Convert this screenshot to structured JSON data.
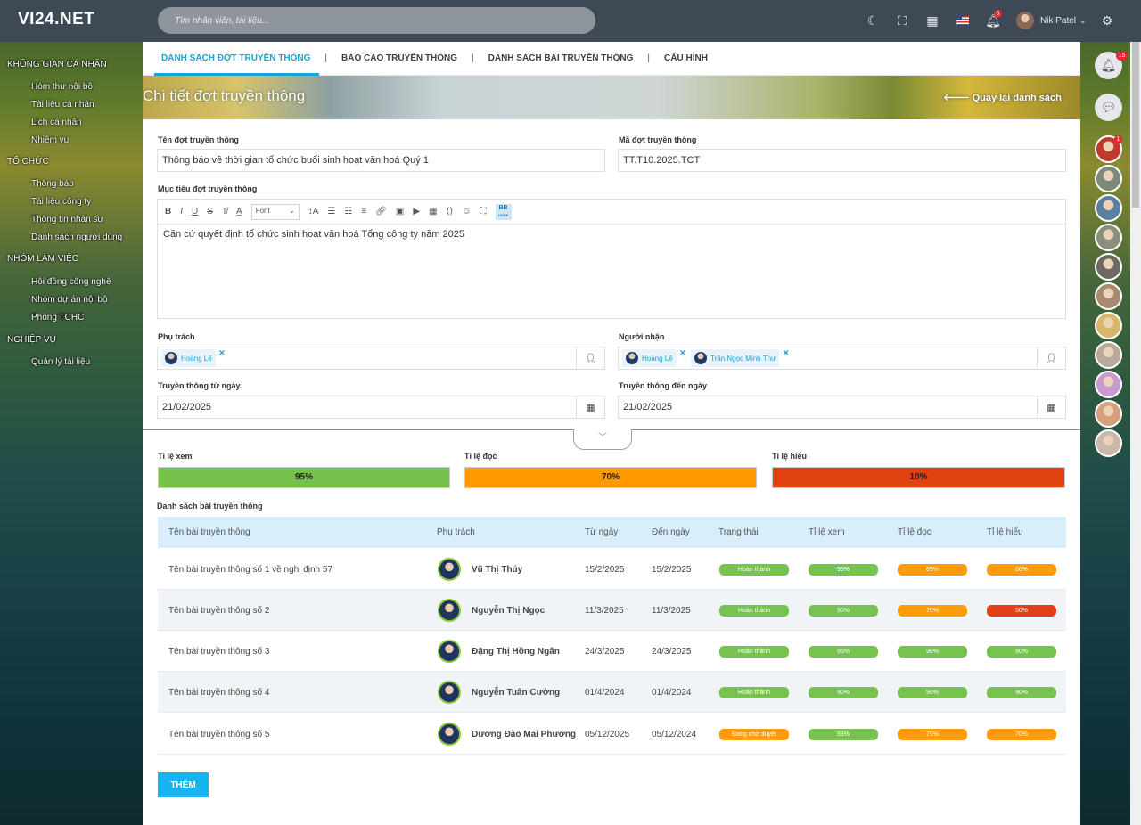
{
  "app": {
    "logo": "VI24.NET",
    "search_placeholder": "Tìm nhân viên, tài liệu...",
    "user_name": "Nik Patel",
    "user_caret": "⌄",
    "notif_count": "6"
  },
  "sidebar": [
    {
      "section": "KHÔNG GIAN CÁ NHÂN",
      "items": [
        "Hòm thư nội bộ",
        "Tài liệu cá nhân",
        "Lịch cá nhân",
        "Nhiệm vụ"
      ]
    },
    {
      "section": "TỔ CHỨC",
      "items": [
        "Thông báo",
        "Tài liệu công ty",
        "Thông tin nhân sự",
        "Danh sách người dùng"
      ]
    },
    {
      "section": "NHÓM LÀM VIỆC",
      "items": [
        "Hội đồng công nghệ",
        "Nhóm dự án nội bộ",
        "Phòng TCHC"
      ]
    },
    {
      "section": "NGHIỆP VỤ",
      "items": [
        "Quản lý tài liệu"
      ]
    }
  ],
  "tabs": [
    "DANH SÁCH ĐỢT TRUYỀN THÔNG",
    "BÁO CÁO TRUYỀN THÔNG",
    "DANH SÁCH BÀI TRUYỀN THÔNG",
    "CẤU HÌNH"
  ],
  "tab_sep": "|",
  "banner": {
    "title": "Chi tiết đợt truyền thông",
    "back": "Quay lại danh sách"
  },
  "form": {
    "name_label": "Tên đợt truyền thông",
    "name_value": "Thông báo về thời gian tổ chức buổi sinh hoạt văn hoá Quý 1",
    "code_label": "Mã đợt truyền thông",
    "code_value": "TT.T10.2025.TCT",
    "goal_label": "Mục tiêu đợt truyền thông",
    "goal_value": "Căn cứ quyết định tổ chức sinh hoạt văn hoá Tổng công ty năm 2025",
    "editor_font": "Font",
    "editor_bb": "BB",
    "editor_code": "CODE",
    "owner_label": "Phụ trách",
    "owner_chips": [
      "Hoàng Lê"
    ],
    "receiver_label": "Người nhận",
    "receiver_chips": [
      "Hoàng Lê",
      "Trần Ngọc Minh Thư"
    ],
    "from_label": "Truyền thông từ ngày",
    "from_value": "21/02/2025",
    "to_label": "Truyền thông đến ngày",
    "to_value": "21/02/2025"
  },
  "rates": [
    {
      "label": "Tỉ lệ xem",
      "value": "95%",
      "color": "#75c14b"
    },
    {
      "label": "Tỉ lệ đọc",
      "value": "70%",
      "color": "#ff9a00"
    },
    {
      "label": "Tỉ lệ hiểu",
      "value": "10%",
      "color": "#e24110"
    }
  ],
  "table": {
    "title": "Danh sách bài truyền thông",
    "headers": [
      "Tên bài truyền thông",
      "Phụ trách",
      "Từ ngày",
      "Đến ngày",
      "Trạng thái",
      "Tỉ lệ xem",
      "Tỉ lệ đọc",
      "Tỉ lệ hiểu"
    ],
    "rows": [
      {
        "name": "Tên bài truyền thông số 1 về nghị định 57",
        "owner": "Vũ Thị Thúy",
        "from": "15/2/2025",
        "to": "15/2/2025",
        "status": "Hoàn thành",
        "status_color": "g",
        "view": "95%",
        "read": "65%",
        "read_color": "o",
        "und": "60%",
        "und_color": "o"
      },
      {
        "name": "Tên bài truyền thông số 2",
        "owner": "Nguyễn Thị Ngọc",
        "from": "11/3/2025",
        "to": "11/3/2025",
        "status": "Hoàn thành",
        "status_color": "g",
        "view": "90%",
        "read": "70%",
        "read_color": "o",
        "und": "50%",
        "und_color": "r"
      },
      {
        "name": "Tên bài truyền thông số 3",
        "owner": "Đặng Thị Hồng Ngân",
        "from": "24/3/2025",
        "to": "24/3/2025",
        "status": "Hoàn thành",
        "status_color": "g",
        "view": "96%",
        "read": "90%",
        "read_color": "g",
        "und": "90%",
        "und_color": "g"
      },
      {
        "name": "Tên bài truyền thông số 4",
        "owner": "Nguyễn Tuấn Cường",
        "from": "01/4/2024",
        "to": "01/4/2024",
        "status": "Hoàn thành",
        "status_color": "g",
        "view": "90%",
        "read": "90%",
        "read_color": "g",
        "und": "90%",
        "und_color": "g"
      },
      {
        "name": "Tên bài truyền thông số 5",
        "owner": "Dương Đào Mai Phương",
        "from": "05/12/2025",
        "to": "05/12/2024",
        "status": "Đang chờ duyệt",
        "status_color": "o",
        "view": "93%",
        "read": "75%",
        "read_color": "o",
        "und": "70%",
        "und_color": "o"
      }
    ]
  },
  "add_button": "THÊM",
  "rightbar": {
    "notif_badge": "15",
    "contact_badge": "1"
  }
}
